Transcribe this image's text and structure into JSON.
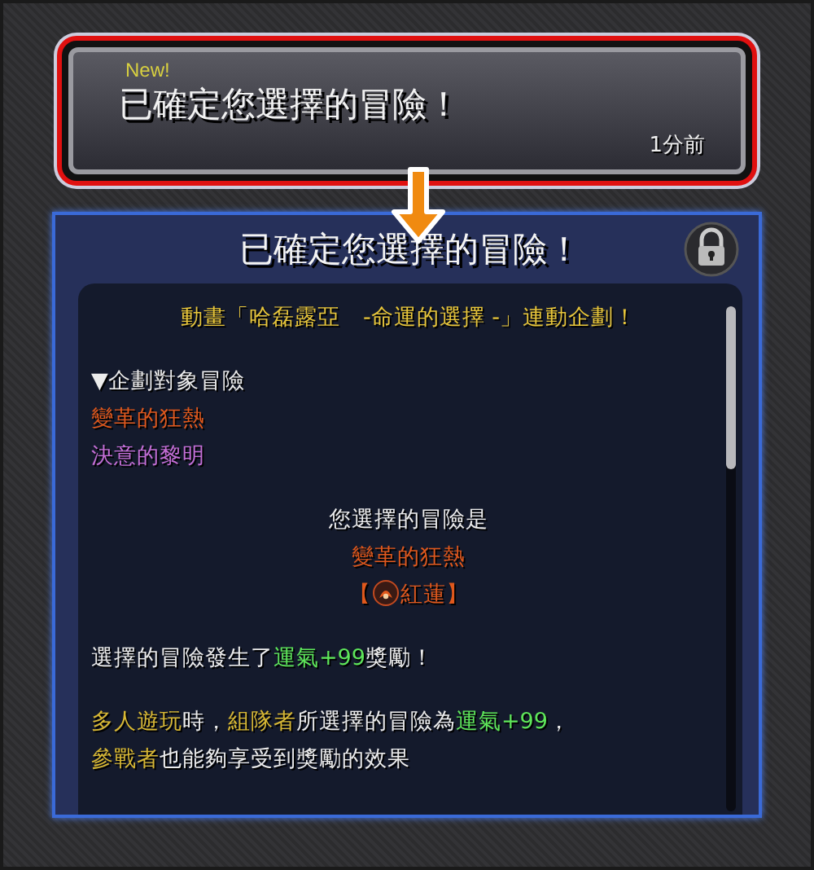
{
  "notification": {
    "badge": "New!",
    "title": "已確定您選擇的冒險！",
    "time": "1分前",
    "selected": true
  },
  "panel": {
    "title": "已確定您選擇的冒險！",
    "locked": true,
    "paragraphs": [
      {
        "kind": "centered",
        "lines": [
          {
            "segments": [
              {
                "text": "動畫「哈磊露亞　-命運的選擇 -」連動企劃！",
                "color": "#e8c63a"
              }
            ]
          }
        ]
      },
      {
        "kind": "left",
        "lines": [
          {
            "segments": [
              {
                "text": "▼企劃對象冒險",
                "color": "#ececec"
              }
            ]
          },
          {
            "segments": [
              {
                "text": "變革的狂熱",
                "color": "#e0581c"
              }
            ]
          },
          {
            "segments": [
              {
                "text": "決意的黎明",
                "color": "#c46ed6"
              }
            ]
          }
        ]
      },
      {
        "kind": "centered",
        "lines": [
          {
            "segments": [
              {
                "text": "您選擇的冒險是",
                "color": "#ececec"
              }
            ]
          },
          {
            "segments": [
              {
                "text": "變革的狂熱",
                "color": "#e0581c"
              }
            ]
          },
          {
            "emblem": true,
            "segments": [
              {
                "text": "【",
                "color": "#e0581c"
              },
              {
                "text": "紅蓮】",
                "color": "#e0581c"
              }
            ]
          }
        ]
      },
      {
        "kind": "left",
        "lines": [
          {
            "segments": [
              {
                "text": "選擇的冒險發生了",
                "color": "#ececec"
              },
              {
                "text": "運氣+99",
                "color": "#5ee65a"
              },
              {
                "text": "獎勵！",
                "color": "#ececec"
              }
            ]
          }
        ]
      },
      {
        "kind": "left",
        "lines": [
          {
            "segments": [
              {
                "text": "多人遊玩",
                "color": "#d8b834"
              },
              {
                "text": "時，",
                "color": "#ececec"
              },
              {
                "text": "組隊者",
                "color": "#d8b834"
              },
              {
                "text": "所選擇的冒險為",
                "color": "#ececec"
              },
              {
                "text": "運氣+99",
                "color": "#5ee65a"
              },
              {
                "text": "，",
                "color": "#ececec"
              }
            ]
          },
          {
            "segments": [
              {
                "text": "參戰者",
                "color": "#d8b834"
              },
              {
                "text": "也能夠享受到獎勵的效果",
                "color": "#ececec"
              }
            ]
          }
        ]
      }
    ]
  }
}
